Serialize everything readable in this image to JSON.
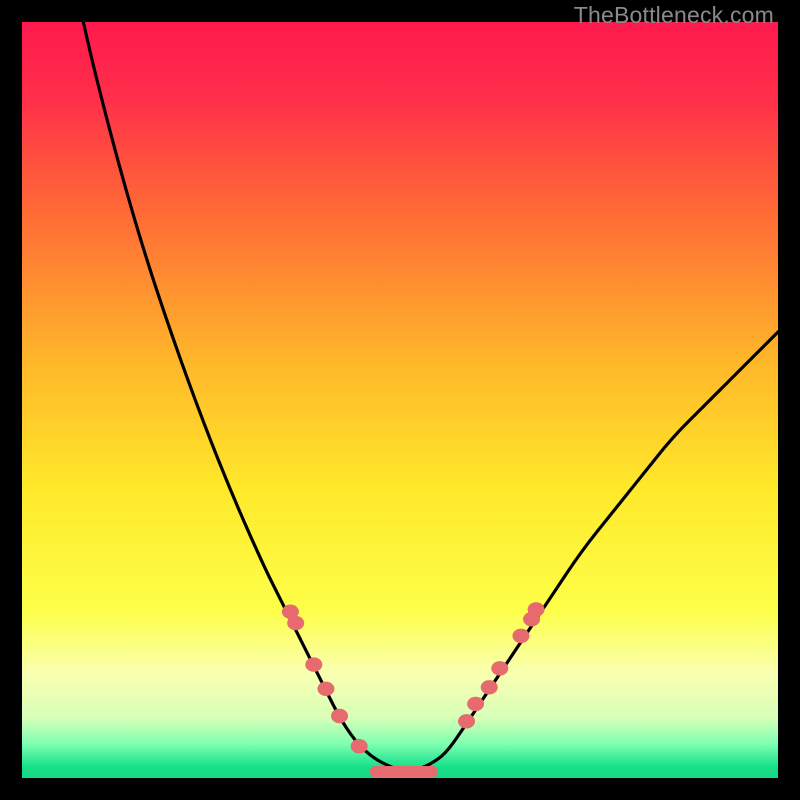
{
  "watermark": "TheBottleneck.com",
  "colors": {
    "frame": "#000000",
    "gradient_stops": [
      {
        "offset": 0.0,
        "color": "#ff1a4d"
      },
      {
        "offset": 0.1,
        "color": "#ff2e4a"
      },
      {
        "offset": 0.25,
        "color": "#ff6a36"
      },
      {
        "offset": 0.45,
        "color": "#ffb72a"
      },
      {
        "offset": 0.62,
        "color": "#ffe92a"
      },
      {
        "offset": 0.78,
        "color": "#fdff4a"
      },
      {
        "offset": 0.86,
        "color": "#faffb0"
      },
      {
        "offset": 0.92,
        "color": "#d8ffb8"
      },
      {
        "offset": 0.955,
        "color": "#7dffb0"
      },
      {
        "offset": 0.985,
        "color": "#18e08a"
      },
      {
        "offset": 1.0,
        "color": "#15d884"
      }
    ],
    "curve": "#000000",
    "marker_fill": "#e66a6e",
    "marker_stroke": "#c94f55"
  },
  "chart_data": {
    "type": "line",
    "title": "",
    "xlabel": "",
    "ylabel": "",
    "xlim": [
      0,
      100
    ],
    "ylim": [
      0,
      100
    ],
    "grid": false,
    "legend": false,
    "series": [
      {
        "name": "bottleneck-curve",
        "x": [
          0,
          4,
          8,
          12,
          16,
          20,
          24,
          28,
          32,
          34,
          36,
          38,
          40,
          42,
          44,
          46,
          48,
          50,
          52,
          54,
          56,
          58,
          62,
          66,
          70,
          74,
          78,
          82,
          86,
          90,
          94,
          100
        ],
        "y": [
          147,
          120,
          100,
          84,
          70,
          58,
          47,
          37,
          28,
          24,
          20,
          16,
          12,
          8,
          5,
          3,
          1.8,
          1.0,
          1.0,
          1.8,
          3.2,
          6,
          12,
          18,
          24,
          30,
          35,
          40,
          45,
          49,
          53,
          59
        ]
      }
    ],
    "markers_left": [
      {
        "x": 35.5,
        "y": 22.0
      },
      {
        "x": 36.2,
        "y": 20.5
      },
      {
        "x": 38.6,
        "y": 15.0
      },
      {
        "x": 40.2,
        "y": 11.8
      },
      {
        "x": 42.0,
        "y": 8.2
      },
      {
        "x": 44.6,
        "y": 4.2
      }
    ],
    "markers_right": [
      {
        "x": 58.8,
        "y": 7.5
      },
      {
        "x": 60.0,
        "y": 9.8
      },
      {
        "x": 61.8,
        "y": 12.0
      },
      {
        "x": 63.2,
        "y": 14.5
      },
      {
        "x": 66.0,
        "y": 18.8
      },
      {
        "x": 67.4,
        "y": 21.0
      },
      {
        "x": 68.0,
        "y": 22.3
      }
    ],
    "flat_segment": {
      "x0": 46,
      "x1": 55,
      "y": 1.0,
      "thickness": 7
    }
  }
}
